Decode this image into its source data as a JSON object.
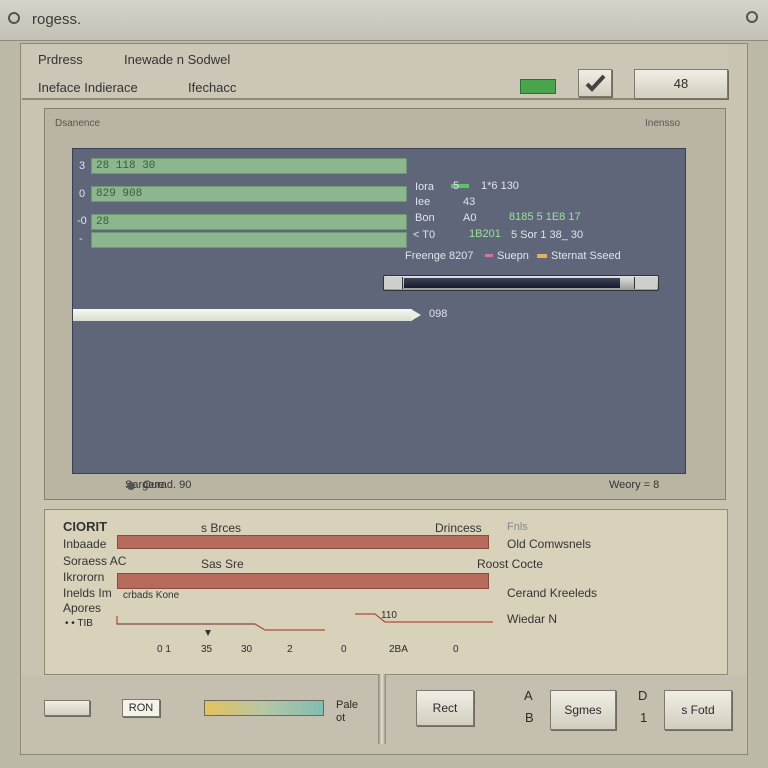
{
  "window": {
    "title": "rogess."
  },
  "header": {
    "line1_left": "Prdress",
    "line1_right": "Inewade n Sodwel",
    "line2_left": "Ineface Indierace",
    "line2_right": "Ifechacc",
    "value_box": "48"
  },
  "panel": {
    "title_left": "Dsanence",
    "title_right": "Inensso",
    "bars": [
      {
        "marker": "3",
        "label": "28 118 30",
        "fill": 1.0
      },
      {
        "marker": "0",
        "label": "829 908",
        "fill": 1.0
      },
      {
        "marker": "-0",
        "label": "28",
        "fill": 1.0
      },
      {
        "marker": "-",
        "label": "",
        "fill": 1.0
      }
    ],
    "right_readouts": [
      {
        "a": "Iora",
        "b": "5",
        "c": "1*6 130"
      },
      {
        "a": "Iee",
        "b": "43",
        "c": ""
      },
      {
        "a": "Bon",
        "b": "A0",
        "c": "8185 5  1E8 17"
      },
      {
        "a": "< T0",
        "b": "1B201",
        "c": "5  Sor   1 38_ 30"
      }
    ],
    "legend": {
      "left": "Freenge 8207",
      "mid": "Suepn",
      "right": "Sternat Sseed"
    },
    "progress_value": "0.98",
    "progress_label": "098",
    "footer_left": "Sargere",
    "footer_mid": "Curad. 90",
    "footer_right": "Weory = 8"
  },
  "lower": {
    "title": "CIORIT",
    "rows": [
      {
        "label": "Inbaade",
        "mid": "s Brces",
        "right": "Drincess"
      },
      {
        "label": "Soraess AC",
        "mid": "Sas Sre",
        "right": "Roost Cocte"
      },
      {
        "label": "Ikrororn",
        "mid": "",
        "right": ""
      },
      {
        "label": "Inelds Im",
        "mid": "crbads   Kone",
        "right": ""
      },
      {
        "label": "Apores",
        "mid": "",
        "right": ""
      }
    ],
    "bar_values": [
      1.0,
      1.0
    ],
    "right_col": [
      "Fnls",
      "Old Comwsnels",
      "Cerand Kreeleds",
      "Wiedar N"
    ],
    "mini_labels": [
      "• •  TIB",
      "110"
    ],
    "axis_ticks": [
      "0 1",
      "35",
      "30",
      "2",
      "0",
      "2BA",
      "0"
    ]
  },
  "toolbar": {
    "ron_label": "RON",
    "gradient_label_1": "Pale",
    "gradient_label_2": "ot",
    "rect_button": "Rect",
    "a_label": "A",
    "square_label": "B",
    "segments_button": "Sgmes",
    "d_label": "D",
    "s_label": "1",
    "fold_button": "s Fotd"
  },
  "colors": {
    "panel_dark": "#5f6679",
    "bar_green": "#8cb68d",
    "bar_red": "#b76b5c"
  }
}
